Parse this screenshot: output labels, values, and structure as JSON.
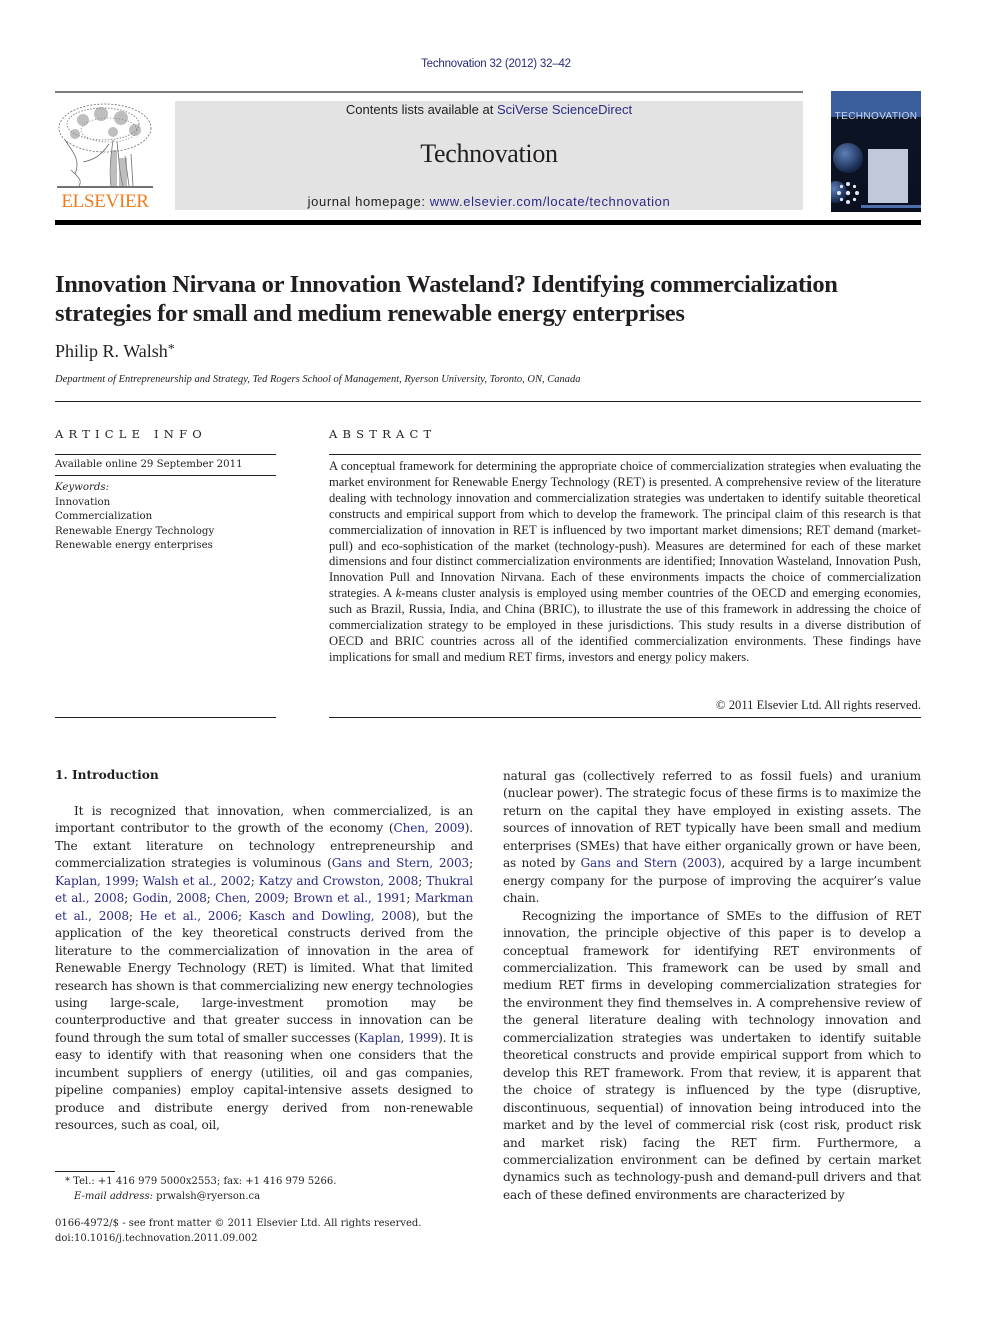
{
  "journal_citation": "Technovation 32 (2012) 32–42",
  "masthead": {
    "contents_prefix": "Contents lists available at ",
    "contents_link": "SciVerse ScienceDirect",
    "journal_name": "Technovation",
    "homepage_prefix": "journal homepage: ",
    "homepage_link": "www.elsevier.com/locate/technovation",
    "publisher_logo_text": "ELSEVIER",
    "cover_title": "TECHNOVATION"
  },
  "article": {
    "title": "Innovation Nirvana or Innovation Wasteland? Identifying commercialization strategies for small and medium renewable energy enterprises",
    "author": "Philip R. Walsh",
    "author_mark": "*",
    "affiliation": "Department of Entrepreneurship and Strategy, Ted Rogers School of Management, Ryerson University, Toronto, ON, Canada"
  },
  "article_info": {
    "heading": "ARTICLE INFO",
    "available_online": "Available online 29 September 2011",
    "keywords_label": "Keywords:",
    "keywords": [
      "Innovation",
      "Commercialization",
      "Renewable Energy Technology",
      "Renewable energy enterprises"
    ]
  },
  "abstract": {
    "heading": "ABSTRACT",
    "text_before_k": "A conceptual framework for determining the appropriate choice of commercialization strategies when evaluating the market environment for Renewable Energy Technology (RET) is presented. A comprehensive review of the literature dealing with technology innovation and commercialization strategies was undertaken to identify suitable theoretical constructs and empirical support from which to develop the framework. The principal claim of this research is that commercialization of innovation in RET is influenced by two important market dimensions; RET demand (market-pull) and eco-sophistication of the market (technology-push). Measures are determined for each of these market dimensions and four distinct commercialization environments are identified; Innovation Wasteland, Innovation Push, Innovation Pull and Innovation Nirvana. Each of these environments impacts the choice of commercialization strategies. A ",
    "k_italic": "k",
    "text_after_k": "-means cluster analysis is employed using member countries of the OECD and emerging economies, such as Brazil, Russia, India, and China (BRIC), to illustrate the use of this framework in addressing the choice of commercialization strategy to be employed in these jurisdictions. This study results in a diverse distribution of OECD and BRIC countries across all of the identified commercialization environments. These findings have implications for small and medium RET firms, investors and energy policy makers.",
    "copyright": "© 2011 Elsevier Ltd. All rights reserved."
  },
  "intro": {
    "heading": "1.  Introduction",
    "p1": [
      {
        "t": "It is recognized that innovation, when commercialized, is an important contributor to the growth of the economy ("
      },
      {
        "t": "Chen, 2009",
        "link": true
      },
      {
        "t": "). The extant literature on technology entrepreneurship and commercialization strategies is voluminous ("
      },
      {
        "t": "Gans and Stern, 2003",
        "link": true
      },
      {
        "t": "; "
      },
      {
        "t": "Kaplan, 1999",
        "link": true
      },
      {
        "t": "; "
      },
      {
        "t": "Walsh et al., 2002",
        "link": true
      },
      {
        "t": "; "
      },
      {
        "t": "Katzy and Crowston, 2008",
        "link": true
      },
      {
        "t": "; "
      },
      {
        "t": "Thukral et al., 2008",
        "link": true
      },
      {
        "t": "; "
      },
      {
        "t": "Godin, 2008",
        "link": true
      },
      {
        "t": "; "
      },
      {
        "t": "Chen, 2009",
        "link": true
      },
      {
        "t": "; "
      },
      {
        "t": "Brown et al., 1991",
        "link": true
      },
      {
        "t": "; "
      },
      {
        "t": "Markman et al., 2008",
        "link": true
      },
      {
        "t": "; "
      },
      {
        "t": "He et al., 2006",
        "link": true
      },
      {
        "t": "; "
      },
      {
        "t": "Kasch and Dowling, 2008",
        "link": true
      },
      {
        "t": "), but the application of the key theoretical constructs derived from the literature to the commercialization of innovation in the area of Renewable Energy Technology (RET) is limited. What that limited research has shown is that commercializing new energy technologies using large-scale, large-investment promotion may be counterproductive and that greater success in innovation can be found through the sum total of smaller successes ("
      },
      {
        "t": "Kaplan, 1999",
        "link": true
      },
      {
        "t": "). It is easy to identify with that reasoning when one considers that the incumbent suppliers of energy (utilities, oil and gas companies, pipeline companies) employ capital-intensive assets designed to produce and distribute energy derived from non-renewable resources, such as coal, oil, "
      }
    ],
    "p1_cont": [
      {
        "t": "natural gas (collectively referred to as fossil fuels) and uranium (nuclear power). The strategic focus of these firms is to maximize the return on the capital they have employed in existing assets. The sources of innovation of RET typically have been small and medium enterprises (SMEs) that have either organically grown or have been, as noted by "
      },
      {
        "t": "Gans and Stern (2003)",
        "link": true
      },
      {
        "t": ", acquired by a large incumbent energy company for the purpose of improving the acquirer’s value chain."
      }
    ],
    "p2": "Recognizing the importance of SMEs to the diffusion of RET innovation, the principle objective of this paper is to develop a conceptual framework for identifying RET environments of commercialization. This framework can be used by small and medium RET firms in developing commercialization strategies for the environment they find themselves in. A comprehensive review of the general literature dealing with technology innovation and commercialization strategies was undertaken to identify suitable theoretical constructs and provide empirical support from which to develop this RET framework. From that review, it is apparent that the choice of strategy is influenced by the type (disruptive, discontinuous, sequential) of innovation being introduced into the market and by the level of commercial risk (cost risk, product risk and market risk) facing the RET firm. Furthermore, a commercialization environment can be defined by certain market dynamics such as technology-push and demand-pull drivers and that each of these defined environments are characterized by"
  },
  "footnote": {
    "tel_line": "* Tel.: +1 416 979 5000x2553; fax: +1 416 979 5266.",
    "email_label": "E-mail address:",
    "email": "prwalsh@ryerson.ca",
    "front_matter": "0166-4972/$ - see front matter © 2011 Elsevier Ltd. All rights reserved.",
    "doi": "doi:10.1016/j.technovation.2011.09.002"
  },
  "colors": {
    "link": "#2b2b84",
    "elsevier_orange": "#f07c1f",
    "masthead_bg": "#e3e3e3"
  }
}
